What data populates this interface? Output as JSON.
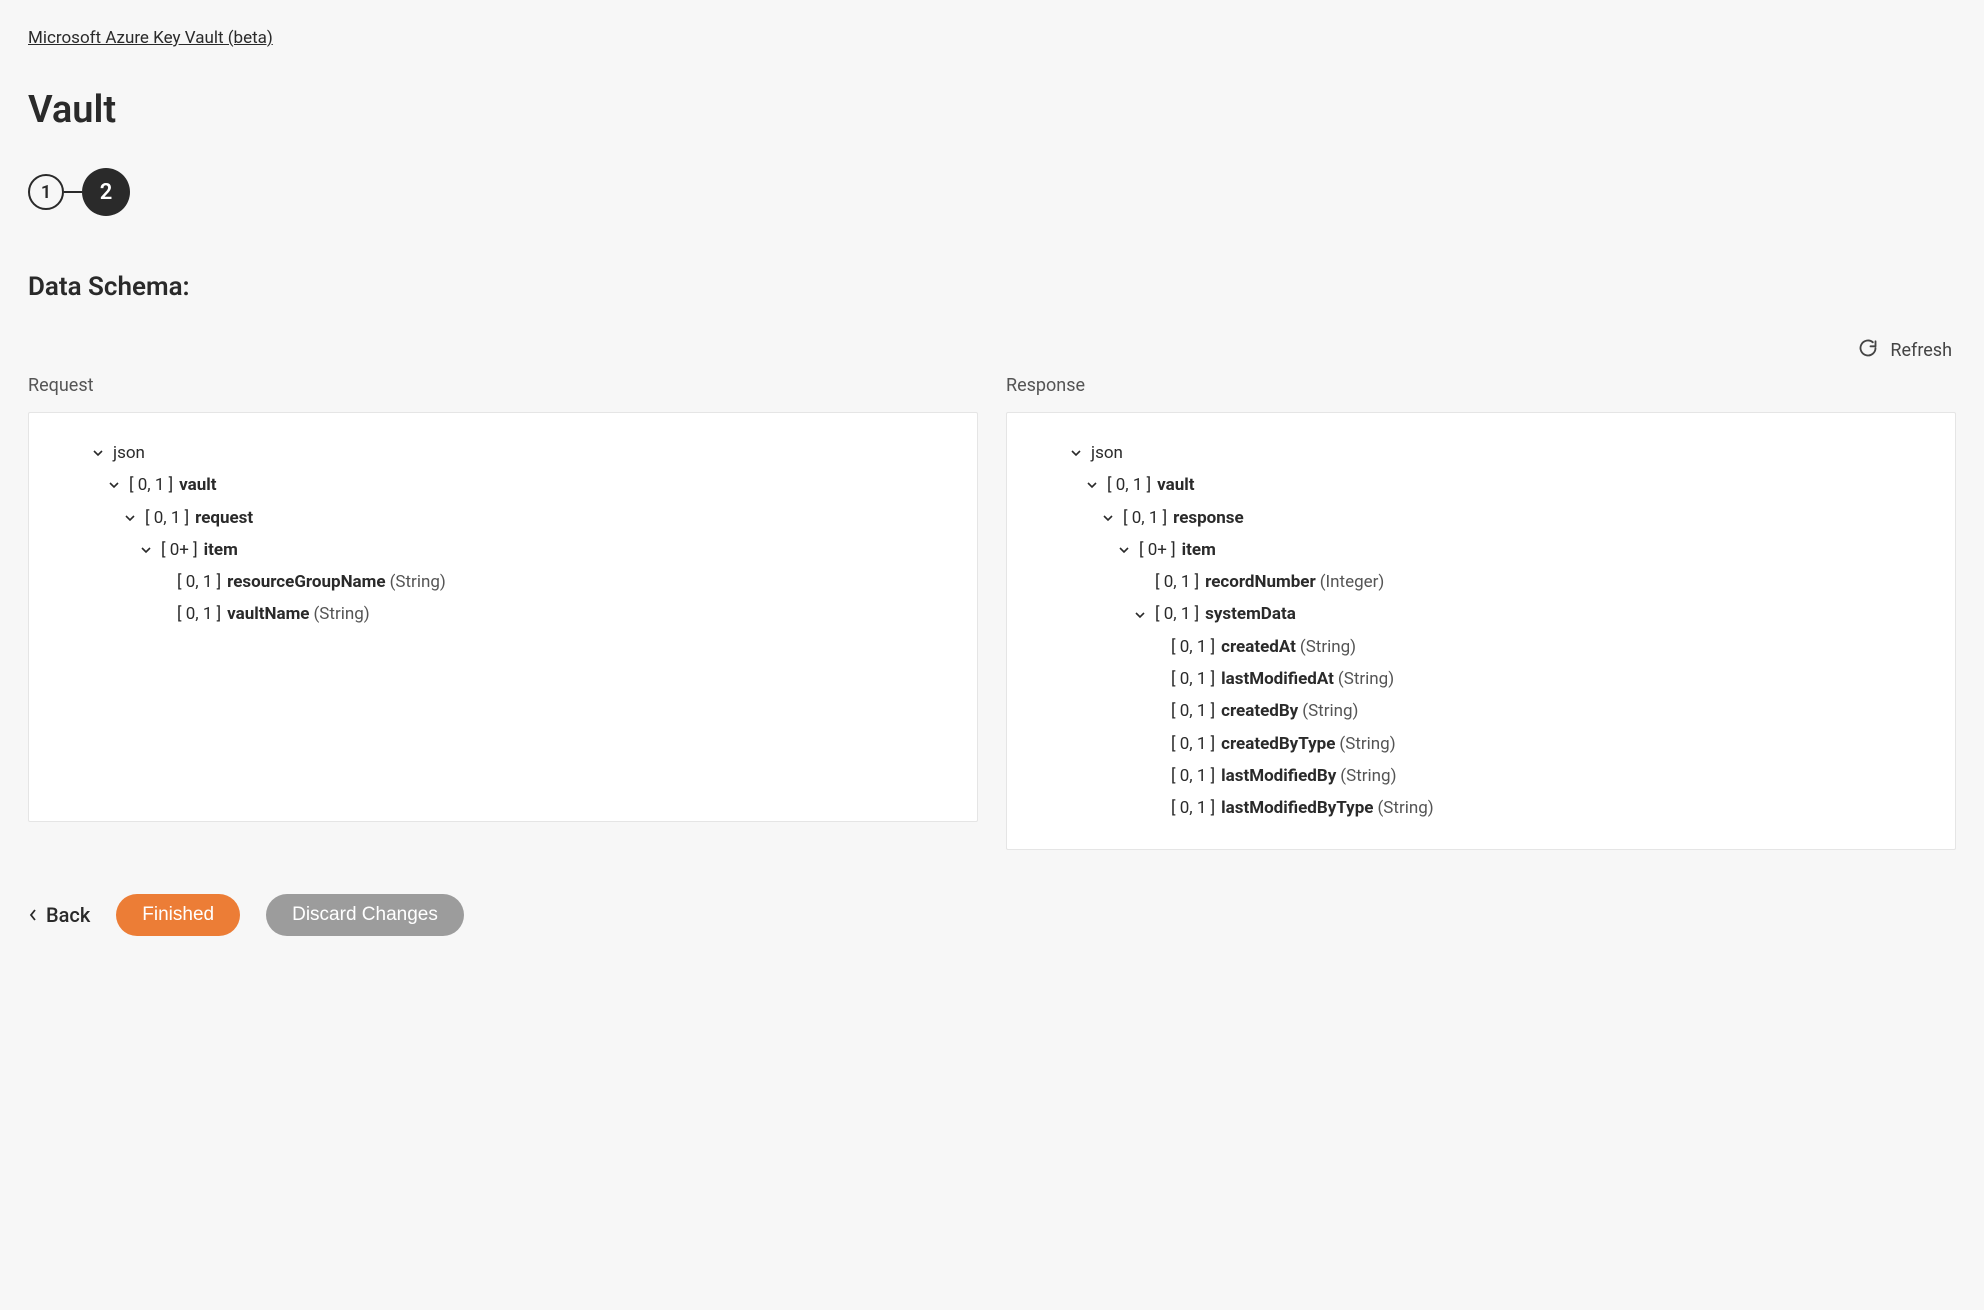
{
  "breadcrumb": "Microsoft Azure Key Vault (beta)",
  "page_title": "Vault",
  "stepper": {
    "step1": "1",
    "step2": "2"
  },
  "section_title": "Data Schema:",
  "refresh_label": "Refresh",
  "columns": {
    "request_label": "Request",
    "response_label": "Response"
  },
  "request_tree": {
    "root": "json",
    "vault_card": "[ 0, 1 ]",
    "vault_name": "vault",
    "request_card": "[ 0, 1 ]",
    "request_name": "request",
    "item_card": "[ 0+ ]",
    "item_name": "item",
    "rgn_card": "[ 0, 1 ]",
    "rgn_name": "resourceGroupName",
    "rgn_type": "(String)",
    "vn_card": "[ 0, 1 ]",
    "vn_name": "vaultName",
    "vn_type": "(String)"
  },
  "response_tree": {
    "root": "json",
    "vault_card": "[ 0, 1 ]",
    "vault_name": "vault",
    "response_card": "[ 0, 1 ]",
    "response_name": "response",
    "item_card": "[ 0+ ]",
    "item_name": "item",
    "record_card": "[ 0, 1 ]",
    "record_name": "recordNumber",
    "record_type": "(Integer)",
    "sysdata_card": "[ 0, 1 ]",
    "sysdata_name": "systemData",
    "createdAt_card": "[ 0, 1 ]",
    "createdAt_name": "createdAt",
    "createdAt_type": "(String)",
    "lastModifiedAt_card": "[ 0, 1 ]",
    "lastModifiedAt_name": "lastModifiedAt",
    "lastModifiedAt_type": "(String)",
    "createdBy_card": "[ 0, 1 ]",
    "createdBy_name": "createdBy",
    "createdBy_type": "(String)",
    "createdByType_card": "[ 0, 1 ]",
    "createdByType_name": "createdByType",
    "createdByType_type": "(String)",
    "lastModifiedBy_card": "[ 0, 1 ]",
    "lastModifiedBy_name": "lastModifiedBy",
    "lastModifiedBy_type": "(String)",
    "lastModifiedByType_card": "[ 0, 1 ]",
    "lastModifiedByType_name": "lastModifiedByType",
    "lastModifiedByType_type": "(String)"
  },
  "actions": {
    "back": "Back",
    "finished": "Finished",
    "discard": "Discard Changes"
  }
}
